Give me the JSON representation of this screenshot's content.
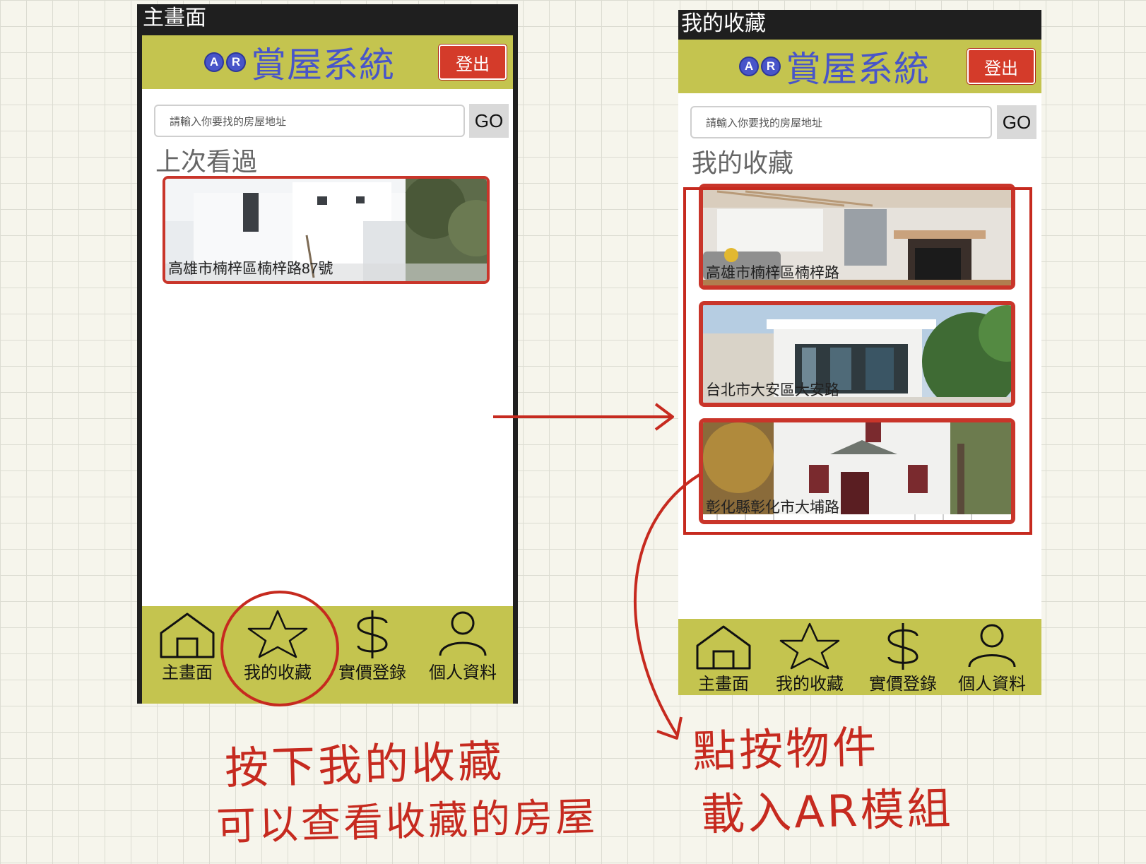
{
  "left_screen": {
    "caption": "主畫面",
    "app_title": "賞屋系統",
    "ar_badge": [
      "A",
      "R"
    ],
    "logout_label": "登出",
    "search_placeholder": "請輸入你要找的房屋地址",
    "go_label": "GO",
    "section_title": "上次看過",
    "cards": [
      {
        "address": "高雄市楠梓區楠梓路87號"
      }
    ],
    "tabs": [
      {
        "label": "主畫面",
        "icon": "home-icon"
      },
      {
        "label": "我的收藏",
        "icon": "star-icon"
      },
      {
        "label": "實價登錄",
        "icon": "dollar-icon"
      },
      {
        "label": "個人資料",
        "icon": "person-icon"
      }
    ]
  },
  "right_screen": {
    "caption": "我的收藏",
    "app_title": "賞屋系統",
    "ar_badge": [
      "A",
      "R"
    ],
    "logout_label": "登出",
    "search_placeholder": "請輸入你要找的房屋地址",
    "go_label": "GO",
    "section_title": "我的收藏",
    "cards": [
      {
        "address": "高雄市楠梓區楠梓路"
      },
      {
        "address": "台北市大安區大安路"
      },
      {
        "address": "彰化縣彰化市大埔路"
      }
    ],
    "tabs": [
      {
        "label": "主畫面",
        "icon": "home-icon"
      },
      {
        "label": "我的收藏",
        "icon": "star-icon"
      },
      {
        "label": "實價登錄",
        "icon": "dollar-icon"
      },
      {
        "label": "個人資料",
        "icon": "person-icon"
      }
    ]
  },
  "annotations": {
    "left_line1": "按下我的收藏",
    "left_line2": "可以查看收藏的房屋",
    "right_line1": "點按物件",
    "right_line2": "載入AR模組",
    "color": "#c62a1f"
  },
  "colors": {
    "app_bar": "#c4c44f",
    "logo_blue": "#4855c9",
    "logout_red": "#d43b2a"
  }
}
